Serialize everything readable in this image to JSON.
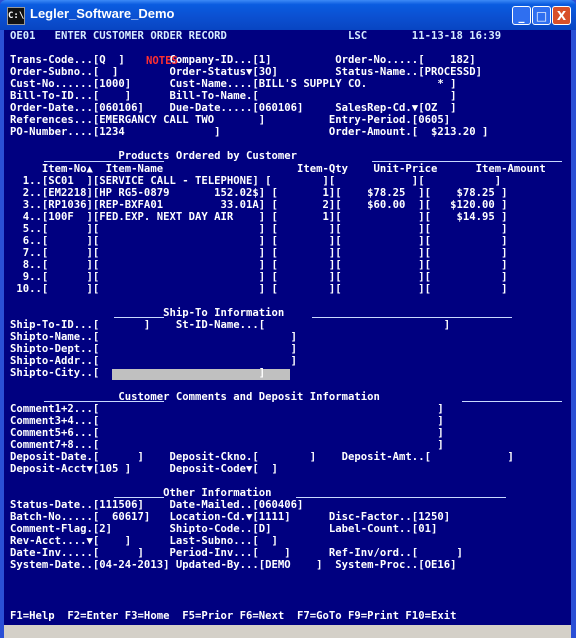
{
  "window": {
    "title": "Legler_Software_Demo",
    "app_icon": "C:\\",
    "min": "_",
    "max": "□",
    "close": "X"
  },
  "screen": {
    "lines": [
      "OE01   ENTER CUSTOMER ORDER RECORD                   LSC       11-13-18 16:39",
      "",
      "Trans-Code...[Q  ]       Company-ID...[1]          Order-No.....[    182]",
      "Order-Subno..[  ]        Order-Status▼[3O]         Status-Name..[PROCESSD]",
      "Cust-No......[1000]      Cust-Name....[BILL'S SUPPLY CO.           * ]",
      "Bill-To-ID...[    ]      Bill-To-Name.[                              ]",
      "Order-Date...[060106]    Due-Date.....[060106]     SalesRep-Cd.▼[OZ  ]",
      "References...[EMERGANCY CALL TWO       ]          Entry-Period.[0605]",
      "PO-Number....[1234              ]                 Order-Amount.[  $213.20 ]",
      "",
      "                 Products Ordered by Customer",
      "     Item-No▲  Item-Name                     Item-Qty    Unit-Price      Item-Amount",
      "  1..[SC01  ][SERVICE CALL - TELEPHONE] [        ][            ][           ]",
      "  2..[EM2218][HP RG5-0879       152.02$] [       1][    $78.25  ][    $78.25 ]",
      "  3..[RP1036][REP-BXFA01         33.01A] [       2][    $60.00  ][   $120.00 ]",
      "  4..[100F  ][FED.EXP. NEXT DAY AIR    ] [       1][            ][    $14.95 ]",
      "  5..[      ][                         ] [        ][            ][           ]",
      "  6..[      ][                         ] [        ][            ][           ]",
      "  7..[      ][                         ] [        ][            ][           ]",
      "  8..[      ][                         ] [        ][            ][           ]",
      "  9..[      ][                         ] [        ][            ][           ]",
      " 10..[      ][                         ] [        ][            ][           ]",
      "",
      "                        Ship-To Information",
      "Ship-To-ID...[       ]    St-ID-Name...[                            ]",
      "Shipto-Name..[                              ]",
      "Shipto-Dept..[                              ]",
      "Shipto-Addr..[                              ]",
      "Shipto-City..[                         ]",
      "",
      "                 Customer Comments and Deposit Information",
      "Comment1+2...[                                                     ]",
      "Comment3+4...[                                                     ]",
      "Comment5+6...[                                                     ]",
      "Comment7+8...[                                                     ]",
      "Deposit-Date.[      ]    Deposit-Ckno.[        ]    Deposit-Amt..[            ]",
      "Deposit-Acct▼[105 ]      Deposit-Code▼[  ]",
      "",
      "                        Other Information",
      "Status-Date..[111506]    Date-Mailed..[060406]",
      "Batch-No.....[  60617]   Location-Cd.▼[1111]      Disc-Factor..[1250]",
      "Comment-Flag.[2]         Shipto-Code..[D]         Label-Count..[01]",
      "Rev-Acct....▼[    ]      Last-Subno...[  ]",
      "Date-Inv.....[      ]    Period-Inv...[    ]      Ref-Inv/ord..[      ]",
      "System-Date..[04-24-2013] Updated-By...[DEMO    ]  System-Proc..[OE16]"
    ],
    "notes_label": "NOTES",
    "fkeys": "F1=Help  F2=Enter F3=Home  F5=Prior F6=Next  F7=GoTo F9=Print F10=Exit"
  }
}
